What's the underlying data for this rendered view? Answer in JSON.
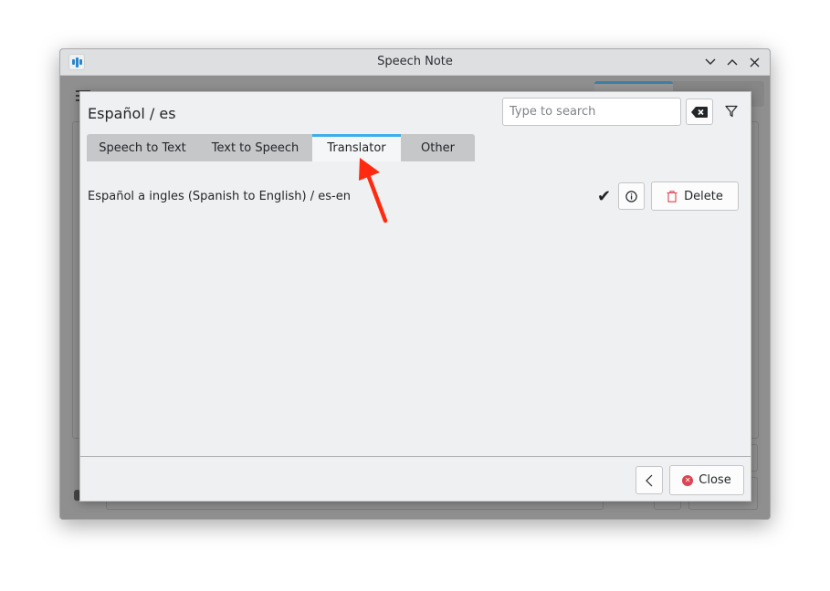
{
  "window": {
    "title": "Speech Note",
    "controls": {
      "minimize_icon": "chevron-down-icon",
      "maximize_icon": "chevron-up-icon",
      "close_icon": "close-icon"
    }
  },
  "dialog": {
    "title": "Español / es",
    "search": {
      "value": "",
      "placeholder": "Type to search"
    },
    "clear_icon": "backspace-clear-icon",
    "filter_icon": "filter-funnel-icon",
    "tabs": [
      {
        "label": "Speech to Text",
        "active": false
      },
      {
        "label": "Text to Speech",
        "active": false
      },
      {
        "label": "Translator",
        "active": true
      },
      {
        "label": "Other",
        "active": false
      }
    ],
    "models": [
      {
        "name": "Español a ingles (Spanish to English) / es-en",
        "enabled_mark": "✔",
        "info_icon": "info-icon",
        "delete_label": "Delete"
      }
    ],
    "footer": {
      "back_icon": "chevron-left-icon",
      "close_label": "Close"
    }
  },
  "annotation": {
    "type": "arrow",
    "color": "#ff2a10",
    "points_to": "Translator tab"
  },
  "colors": {
    "accent": "#3daee9",
    "danger": "#da4453",
    "arrow": "#ff2a10"
  }
}
